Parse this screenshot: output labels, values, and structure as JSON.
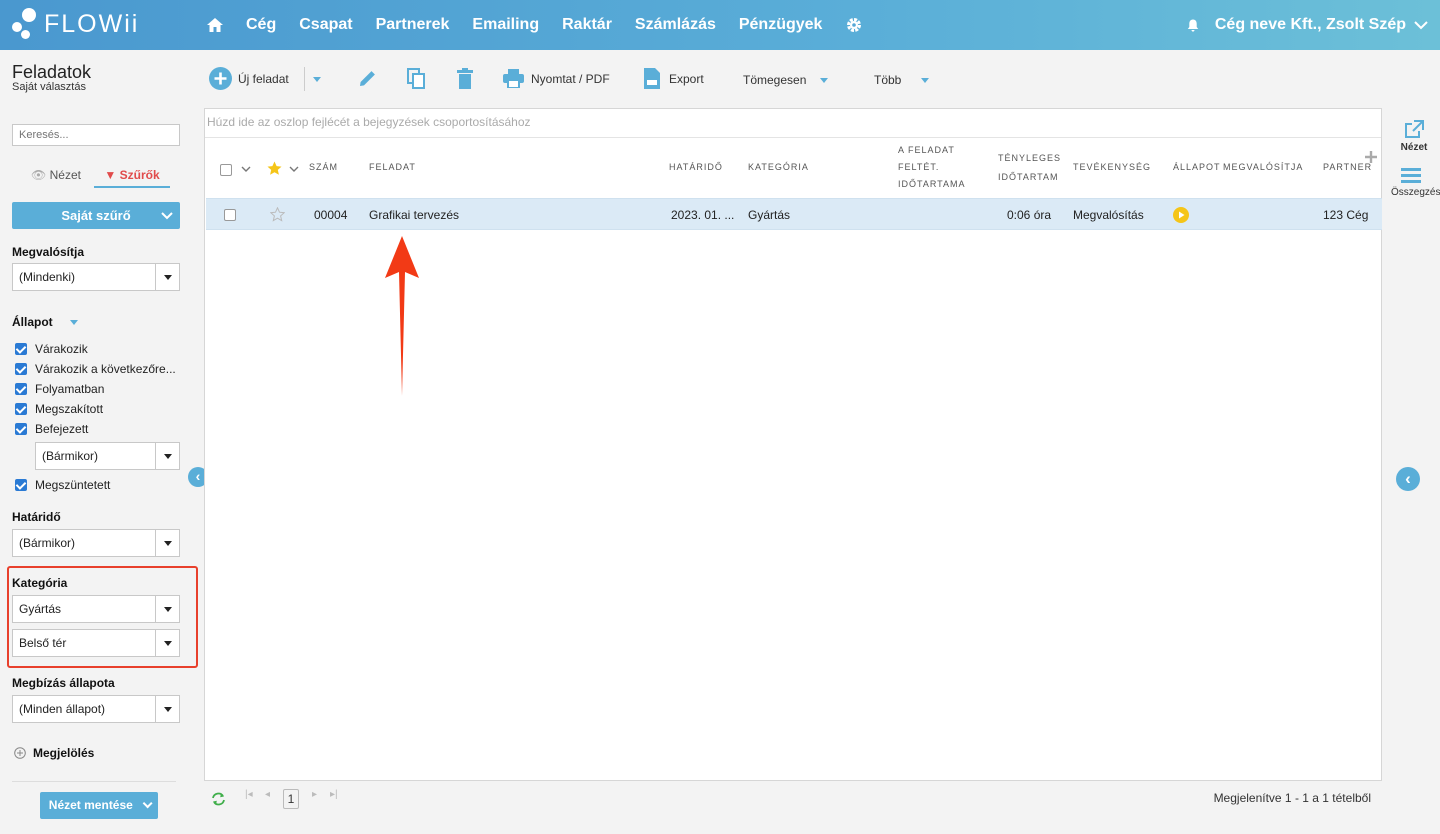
{
  "brand": {
    "name": "FLOWii"
  },
  "nav": {
    "items": [
      "Cég",
      "Csapat",
      "Partnerek",
      "Emailing",
      "Raktár",
      "Számlázás",
      "Pénzügyek"
    ],
    "user": "Cég neve Kft., Zsolt Szép"
  },
  "page": {
    "title": "Feladatok",
    "subtitle": "Saját választás"
  },
  "sidebar": {
    "search_placeholder": "Keresés...",
    "tabs": [
      "Nézet",
      "Szűrők"
    ],
    "filter_button": "Saját szűrő",
    "megvalositja_label": "Megvalósítja",
    "megvalositja_value": "(Mindenki)",
    "allapot_label": "Állapot",
    "statuses": [
      "Várakozik",
      "Várakozik a következőre...",
      "Folyamatban",
      "Megszakított",
      "Befejezett"
    ],
    "befejezett_when": "(Bármikor)",
    "megszuntetett": "Megszüntetett",
    "hatarido_label": "Határidő",
    "hatarido_value": "(Bármikor)",
    "kategoria_label": "Kategória",
    "kategoria_value1": "Gyártás",
    "kategoria_value2": "Belső tér",
    "megbizas_label": "Megbízás állapota",
    "megbizas_value": "(Minden állapot)",
    "megjeloles": "Megjelölés",
    "save_button": "Nézet mentése"
  },
  "toolbar": {
    "new_task": "Új feladat",
    "print": "Nyomtat / PDF",
    "export": "Export",
    "bulk": "Tömegesen",
    "more": "Több"
  },
  "grid": {
    "group_hint": "Húzd ide az oszlop fejlécét a bejegyzések csoportosításához",
    "headers": {
      "szam": "SZÁM",
      "feladat": "FELADAT",
      "hatarido": "HATÁRIDŐ",
      "kategoria": "KATEGÓRIA",
      "feltet1": "A FELADAT",
      "feltet2": "FELTÉT.",
      "feltet3": "IDŐTARTAMA",
      "teny1": "TÉNYLEGES",
      "teny2": "IDŐTARTAM",
      "tevekenyseg": "TEVÉKENYSÉG",
      "allapot": "ÁLLAPOT",
      "megvalositja": "MEGVALÓSÍTJA",
      "partner": "PARTNER"
    },
    "rows": [
      {
        "szam": "00004",
        "feladat": "Grafikai tervezés",
        "hatarido": "2023. 01. ...",
        "kategoria": "Gyártás",
        "teny": "0:06 óra",
        "tevekenyseg": "Megvalósítás",
        "partner": "123 Cég"
      }
    ]
  },
  "footer": {
    "page": "1",
    "summary": "Megjelenítve 1 - 1 a 1 tételből"
  },
  "rail": {
    "view": "Nézet",
    "summary": "Összegzés"
  },
  "colors": {
    "accent": "#5aaed8",
    "highlight": "#e8402c",
    "status": "#f5c518"
  }
}
